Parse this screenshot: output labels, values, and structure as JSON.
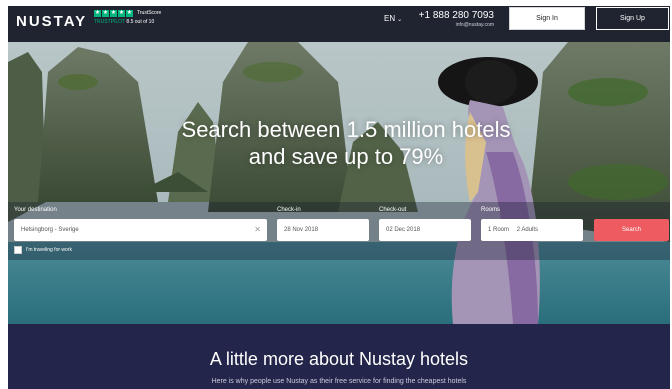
{
  "header": {
    "logo": "NUSTAY",
    "trustpilot": {
      "stars": [
        "★",
        "★",
        "★",
        "★",
        "★"
      ],
      "score_label": "TrustScore",
      "brand": "TRUSTPILOT",
      "rating_text": "8.5 out of 10"
    },
    "language": "EN",
    "phone": "+1 888 280 7093",
    "email": "info@nustay.com",
    "signin_label": "Sign In",
    "signup_label": "Sign Up"
  },
  "hero": {
    "headline_line1": "Search between 1.5 million hotels",
    "headline_line2": "and save up to 79%"
  },
  "search": {
    "destination_label": "Your destination",
    "destination_value": "Helsingborg - Sverige",
    "checkin_label": "Check-in",
    "checkin_value": "28 Nov 2018",
    "checkout_label": "Check-out",
    "checkout_value": "02 Dec 2018",
    "rooms_label": "Rooms",
    "rooms_value": "1 Room",
    "adults_value": "2 Adults",
    "search_label": "Search",
    "work_travel_label": "I'm traveling for work"
  },
  "about": {
    "title": "A little more about Nustay hotels",
    "subtitle": "Here is why people use Nustay as their free service for finding the cheapest hotels"
  },
  "colors": {
    "header_bg": "#1f2430",
    "search_button": "#ee5b60",
    "about_bg": "#23264a",
    "trustpilot_green": "#00b67a"
  }
}
